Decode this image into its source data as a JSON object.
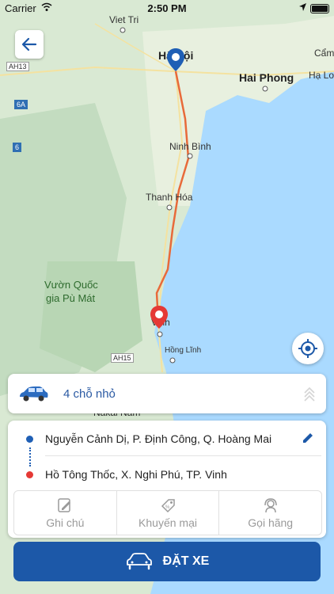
{
  "status_bar": {
    "carrier": "Carrier",
    "time": "2:50 PM"
  },
  "map": {
    "labels": {
      "viet_tri": "Viet Tri",
      "ha_noi": "Hà Nội",
      "hai_phong": "Hai Phong",
      "cam": "Cẩm",
      "ha_long": "Hạ Lo",
      "ninh_binh": "Ninh Bình",
      "thanh_hoa": "Thanh Hóa",
      "vuon_quoc_1": "Vườn Quốc",
      "vuon_quoc_2": "gia Pù Mát",
      "vinh": "Vinh",
      "hong_linh": "Hồng Lĩnh",
      "nakai_nam": "Nakai Nam"
    },
    "road_tags": {
      "ah13": "AH13",
      "r6a": "6A",
      "r6": "6",
      "ah15": "AH15"
    },
    "colors": {
      "route": "#e86a3a",
      "water": "#aadaff",
      "land": "#d7e8d0",
      "pin_start": "#1f5fb5",
      "pin_end": "#e53935"
    }
  },
  "vehicle": {
    "label": "4 chỗ nhỏ"
  },
  "route": {
    "from": "Nguyễn Cảnh Dị, P. Định Công, Q. Hoàng Mai",
    "to": "Hồ Tông Thốc, X. Nghi Phú, TP. Vinh"
  },
  "actions": [
    {
      "label": "Ghi chú",
      "icon": "note-icon"
    },
    {
      "label": "Khuyến mại",
      "icon": "promo-tag-icon"
    },
    {
      "label": "Gọi hãng",
      "icon": "support-headset-icon"
    }
  ],
  "book_button": {
    "label": "ĐẶT XE",
    "icon": "car-icon"
  },
  "colors": {
    "primary": "#1c58a8",
    "accent_text": "#2b5aa3"
  }
}
